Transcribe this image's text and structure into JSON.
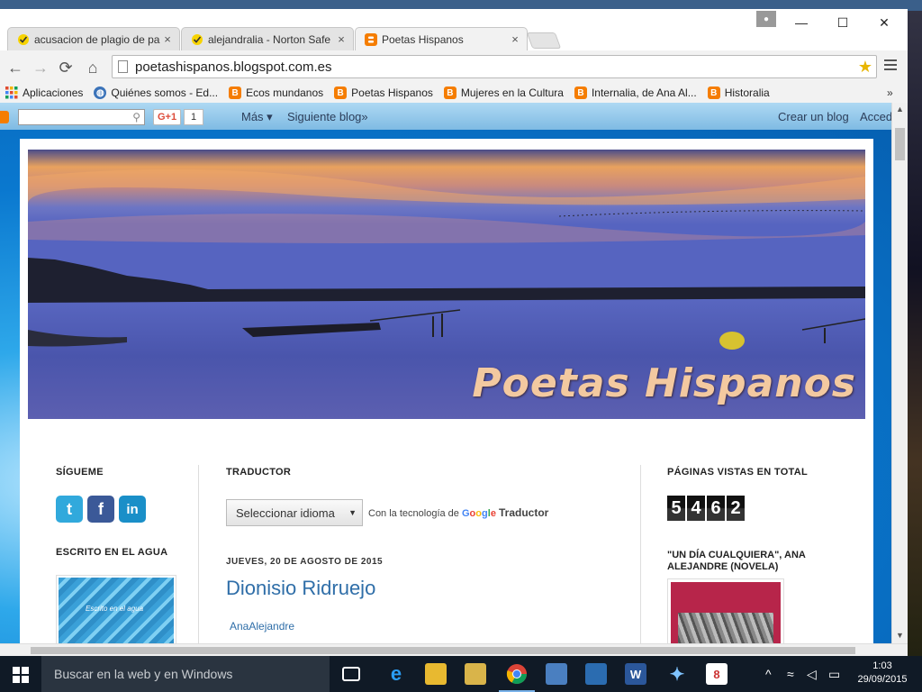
{
  "browser": {
    "tabs": [
      {
        "label": "acusacion de plagio de pa",
        "icon": "norton-check-icon",
        "active": false
      },
      {
        "label": "alejandralia - Norton Safe",
        "icon": "norton-check-icon",
        "active": false
      },
      {
        "label": "Poetas Hispanos",
        "icon": "blogger-icon",
        "active": true
      }
    ],
    "tab_close": "×",
    "url": "poetashispanos.blogspot.com.es",
    "bookmarks": [
      {
        "label": "Aplicaciones",
        "icon": "apps-grid-icon",
        "color": "#e04b2f"
      },
      {
        "label": "Quiénes somos - Ed...",
        "icon": "globe-icon",
        "color": "#3b73b9"
      },
      {
        "label": "Ecos mundanos",
        "icon": "blogger-icon",
        "color": "#f57d00"
      },
      {
        "label": "Poetas Hispanos",
        "icon": "blogger-icon",
        "color": "#f57d00"
      },
      {
        "label": "Mujeres en la Cultura",
        "icon": "blogger-icon",
        "color": "#f57d00"
      },
      {
        "label": "Internalia, de Ana Al...",
        "icon": "blogger-icon",
        "color": "#f57d00"
      },
      {
        "label": "Historalia",
        "icon": "blogger-icon",
        "color": "#f57d00"
      }
    ],
    "bookmarks_more": "»",
    "window_controls": {
      "minimize": "—",
      "maximize": "☐",
      "close": "✕"
    }
  },
  "blogger_bar": {
    "gplus_label": "G+1",
    "gplus_count": "1",
    "more": "Más ▾",
    "next_blog": "Siguiente blog»",
    "create_blog": "Crear un blog",
    "access": "Acceder"
  },
  "blog": {
    "title": "Poetas Hispanos",
    "follow_title": "SÍGUEME",
    "social": [
      {
        "icon": "twitter-icon",
        "glyph": "t",
        "color": "#31a9dc"
      },
      {
        "icon": "facebook-icon",
        "glyph": "f",
        "color": "#3b5998"
      },
      {
        "icon": "linkedin-icon",
        "glyph": "in",
        "color": "#1a8fc8"
      }
    ],
    "water_title": "ESCRITO EN EL AGUA",
    "water_caption": "Escrito en el agua",
    "translator_title": "TRADUCTOR",
    "select_language": "Seleccionar idioma",
    "powered_by": "Con la tecnología de",
    "google": "Google",
    "translator": "Traductor",
    "post_date": "JUEVES, 20 DE AGOSTO DE 2015",
    "post_title": "Dionisio Ridruejo",
    "post_author": "AnaAlejandre",
    "pageviews_title": "PÁGINAS VISTAS EN TOTAL",
    "pageviews_digits": [
      "5",
      "4",
      "6",
      "2"
    ],
    "novel_title": "\"UN DÍA CUALQUIERA\", ANA ALEJANDRE (NOVELA)"
  },
  "taskbar": {
    "search_placeholder": "Buscar en la web y en Windows",
    "time": "1:03",
    "date": "29/09/2015",
    "pinned": [
      {
        "icon": "task-view-icon",
        "glyph": "▭",
        "color": "transparent"
      },
      {
        "icon": "edge-icon",
        "glyph": "e",
        "color": "transparent"
      },
      {
        "icon": "file-explorer-icon",
        "glyph": "▬",
        "color": "#e8b930"
      },
      {
        "icon": "store-icon",
        "glyph": "▤",
        "color": "#d9b44a"
      },
      {
        "icon": "chrome-icon",
        "glyph": "◉",
        "color": "#dd4433"
      },
      {
        "icon": "document-viewer-icon",
        "glyph": "▦",
        "color": "#4a7fc0"
      },
      {
        "icon": "reader-icon",
        "glyph": "▥",
        "color": "#2b6cb0"
      },
      {
        "icon": "word-icon",
        "glyph": "W",
        "color": "#2b579a"
      },
      {
        "icon": "butterfly-app-icon",
        "glyph": "✦",
        "color": "#3a8ee6"
      },
      {
        "icon": "wtd8-app-icon",
        "glyph": "8",
        "color": "#c33"
      }
    ],
    "tray": [
      {
        "icon": "chevron-up-icon",
        "glyph": "^"
      },
      {
        "icon": "wifi-icon",
        "glyph": "≈"
      },
      {
        "icon": "volume-icon",
        "glyph": "◁"
      },
      {
        "icon": "notification-icon",
        "glyph": "▭"
      }
    ]
  }
}
